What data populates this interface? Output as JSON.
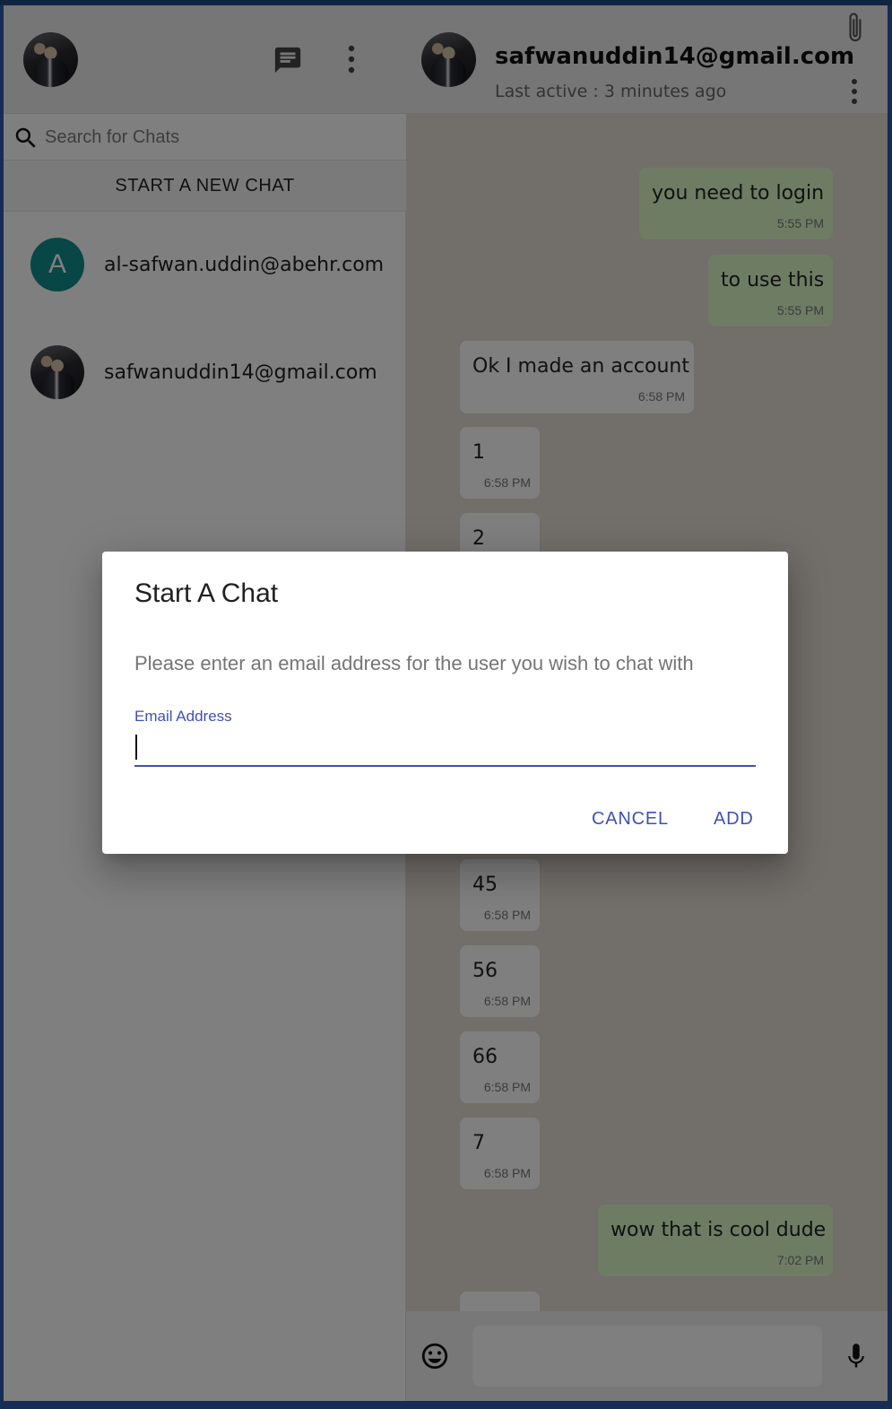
{
  "sidebar": {
    "search_placeholder": "Search for Chats",
    "new_chat_label": "START A NEW CHAT",
    "contacts": [
      {
        "avatar_letter": "A",
        "name": "al-safwan.uddin@abehr.com",
        "avatar_color": "#128c8d"
      },
      {
        "avatar_type": "photo",
        "name": "safwanuddin14@gmail.com"
      }
    ],
    "icons": [
      "chat-icon",
      "more-vert-icon",
      "search-icon"
    ]
  },
  "chat": {
    "title": "safwanuddin14@gmail.com",
    "subtitle": "Last active : 3 minutes ago",
    "messages": [
      {
        "direction": "out",
        "text": "you need to login",
        "time": "5:55 PM"
      },
      {
        "direction": "out",
        "text": "to use this",
        "time": "5:55 PM"
      },
      {
        "direction": "in",
        "text": "Ok I made an account",
        "time": "6:58 PM"
      },
      {
        "direction": "in",
        "text": "1",
        "time": "6:58 PM"
      },
      {
        "direction": "in",
        "text": "2",
        "time": ""
      },
      {
        "direction": "in",
        "text": "45",
        "time": "6:58 PM"
      },
      {
        "direction": "in",
        "text": "56",
        "time": "6:58 PM"
      },
      {
        "direction": "in",
        "text": "66",
        "time": "6:58 PM"
      },
      {
        "direction": "in",
        "text": "7",
        "time": "6:58 PM"
      },
      {
        "direction": "out",
        "text": "wow that is cool dude",
        "time": "7:02 PM"
      }
    ],
    "icons": [
      "attach-icon",
      "more-vert-icon",
      "emoji-icon",
      "mic-icon"
    ],
    "colors": {
      "outgoing": "#dcf8c6",
      "incoming": "#ffffff",
      "background": "#e5ddd5"
    }
  },
  "dialog": {
    "title": "Start A Chat",
    "text": "Please enter an email address for the user you wish to chat with",
    "field_label": "Email Address",
    "field_value": "",
    "cancel_label": "CANCEL",
    "add_label": "ADD",
    "accent_color": "#3f51b5"
  }
}
